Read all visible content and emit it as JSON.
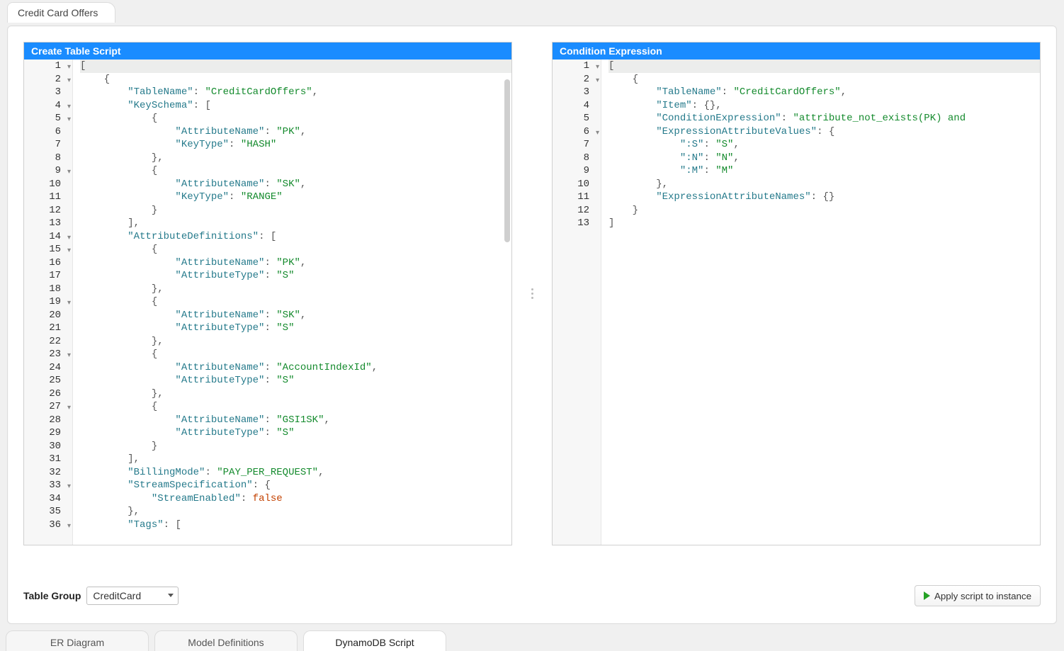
{
  "topTab": {
    "label": "Credit Card Offers"
  },
  "panels": {
    "left": {
      "title": "Create Table Script",
      "gutter": [
        {
          "n": "1",
          "fold": true
        },
        {
          "n": "2",
          "fold": true
        },
        {
          "n": "3",
          "fold": false
        },
        {
          "n": "4",
          "fold": true
        },
        {
          "n": "5",
          "fold": true
        },
        {
          "n": "6",
          "fold": false
        },
        {
          "n": "7",
          "fold": false
        },
        {
          "n": "8",
          "fold": false
        },
        {
          "n": "9",
          "fold": true
        },
        {
          "n": "10",
          "fold": false
        },
        {
          "n": "11",
          "fold": false
        },
        {
          "n": "12",
          "fold": false
        },
        {
          "n": "13",
          "fold": false
        },
        {
          "n": "14",
          "fold": true
        },
        {
          "n": "15",
          "fold": true
        },
        {
          "n": "16",
          "fold": false
        },
        {
          "n": "17",
          "fold": false
        },
        {
          "n": "18",
          "fold": false
        },
        {
          "n": "19",
          "fold": true
        },
        {
          "n": "20",
          "fold": false
        },
        {
          "n": "21",
          "fold": false
        },
        {
          "n": "22",
          "fold": false
        },
        {
          "n": "23",
          "fold": true
        },
        {
          "n": "24",
          "fold": false
        },
        {
          "n": "25",
          "fold": false
        },
        {
          "n": "26",
          "fold": false
        },
        {
          "n": "27",
          "fold": true
        },
        {
          "n": "28",
          "fold": false
        },
        {
          "n": "29",
          "fold": false
        },
        {
          "n": "30",
          "fold": false
        },
        {
          "n": "31",
          "fold": false
        },
        {
          "n": "32",
          "fold": false
        },
        {
          "n": "33",
          "fold": true
        },
        {
          "n": "34",
          "fold": false
        },
        {
          "n": "35",
          "fold": false
        },
        {
          "n": "36",
          "fold": true
        }
      ],
      "code": [
        {
          "hl": true,
          "t": [
            {
              "c": "punc",
              "v": "["
            }
          ]
        },
        {
          "t": [
            {
              "c": "punc",
              "v": "    {"
            }
          ]
        },
        {
          "t": [
            {
              "c": "punc",
              "v": "        "
            },
            {
              "c": "key",
              "v": "\"TableName\""
            },
            {
              "c": "punc",
              "v": ": "
            },
            {
              "c": "str",
              "v": "\"CreditCardOffers\""
            },
            {
              "c": "punc",
              "v": ","
            }
          ]
        },
        {
          "t": [
            {
              "c": "punc",
              "v": "        "
            },
            {
              "c": "key",
              "v": "\"KeySchema\""
            },
            {
              "c": "punc",
              "v": ": ["
            }
          ]
        },
        {
          "t": [
            {
              "c": "punc",
              "v": "            {"
            }
          ]
        },
        {
          "t": [
            {
              "c": "punc",
              "v": "                "
            },
            {
              "c": "key",
              "v": "\"AttributeName\""
            },
            {
              "c": "punc",
              "v": ": "
            },
            {
              "c": "str",
              "v": "\"PK\""
            },
            {
              "c": "punc",
              "v": ","
            }
          ]
        },
        {
          "t": [
            {
              "c": "punc",
              "v": "                "
            },
            {
              "c": "key",
              "v": "\"KeyType\""
            },
            {
              "c": "punc",
              "v": ": "
            },
            {
              "c": "str",
              "v": "\"HASH\""
            }
          ]
        },
        {
          "t": [
            {
              "c": "punc",
              "v": "            },"
            }
          ]
        },
        {
          "t": [
            {
              "c": "punc",
              "v": "            {"
            }
          ]
        },
        {
          "t": [
            {
              "c": "punc",
              "v": "                "
            },
            {
              "c": "key",
              "v": "\"AttributeName\""
            },
            {
              "c": "punc",
              "v": ": "
            },
            {
              "c": "str",
              "v": "\"SK\""
            },
            {
              "c": "punc",
              "v": ","
            }
          ]
        },
        {
          "t": [
            {
              "c": "punc",
              "v": "                "
            },
            {
              "c": "key",
              "v": "\"KeyType\""
            },
            {
              "c": "punc",
              "v": ": "
            },
            {
              "c": "str",
              "v": "\"RANGE\""
            }
          ]
        },
        {
          "t": [
            {
              "c": "punc",
              "v": "            }"
            }
          ]
        },
        {
          "t": [
            {
              "c": "punc",
              "v": "        ],"
            }
          ]
        },
        {
          "t": [
            {
              "c": "punc",
              "v": "        "
            },
            {
              "c": "key",
              "v": "\"AttributeDefinitions\""
            },
            {
              "c": "punc",
              "v": ": ["
            }
          ]
        },
        {
          "t": [
            {
              "c": "punc",
              "v": "            {"
            }
          ]
        },
        {
          "t": [
            {
              "c": "punc",
              "v": "                "
            },
            {
              "c": "key",
              "v": "\"AttributeName\""
            },
            {
              "c": "punc",
              "v": ": "
            },
            {
              "c": "str",
              "v": "\"PK\""
            },
            {
              "c": "punc",
              "v": ","
            }
          ]
        },
        {
          "t": [
            {
              "c": "punc",
              "v": "                "
            },
            {
              "c": "key",
              "v": "\"AttributeType\""
            },
            {
              "c": "punc",
              "v": ": "
            },
            {
              "c": "str",
              "v": "\"S\""
            }
          ]
        },
        {
          "t": [
            {
              "c": "punc",
              "v": "            },"
            }
          ]
        },
        {
          "t": [
            {
              "c": "punc",
              "v": "            {"
            }
          ]
        },
        {
          "t": [
            {
              "c": "punc",
              "v": "                "
            },
            {
              "c": "key",
              "v": "\"AttributeName\""
            },
            {
              "c": "punc",
              "v": ": "
            },
            {
              "c": "str",
              "v": "\"SK\""
            },
            {
              "c": "punc",
              "v": ","
            }
          ]
        },
        {
          "t": [
            {
              "c": "punc",
              "v": "                "
            },
            {
              "c": "key",
              "v": "\"AttributeType\""
            },
            {
              "c": "punc",
              "v": ": "
            },
            {
              "c": "str",
              "v": "\"S\""
            }
          ]
        },
        {
          "t": [
            {
              "c": "punc",
              "v": "            },"
            }
          ]
        },
        {
          "t": [
            {
              "c": "punc",
              "v": "            {"
            }
          ]
        },
        {
          "t": [
            {
              "c": "punc",
              "v": "                "
            },
            {
              "c": "key",
              "v": "\"AttributeName\""
            },
            {
              "c": "punc",
              "v": ": "
            },
            {
              "c": "str",
              "v": "\"AccountIndexId\""
            },
            {
              "c": "punc",
              "v": ","
            }
          ]
        },
        {
          "t": [
            {
              "c": "punc",
              "v": "                "
            },
            {
              "c": "key",
              "v": "\"AttributeType\""
            },
            {
              "c": "punc",
              "v": ": "
            },
            {
              "c": "str",
              "v": "\"S\""
            }
          ]
        },
        {
          "t": [
            {
              "c": "punc",
              "v": "            },"
            }
          ]
        },
        {
          "t": [
            {
              "c": "punc",
              "v": "            {"
            }
          ]
        },
        {
          "t": [
            {
              "c": "punc",
              "v": "                "
            },
            {
              "c": "key",
              "v": "\"AttributeName\""
            },
            {
              "c": "punc",
              "v": ": "
            },
            {
              "c": "str",
              "v": "\"GSI1SK\""
            },
            {
              "c": "punc",
              "v": ","
            }
          ]
        },
        {
          "t": [
            {
              "c": "punc",
              "v": "                "
            },
            {
              "c": "key",
              "v": "\"AttributeType\""
            },
            {
              "c": "punc",
              "v": ": "
            },
            {
              "c": "str",
              "v": "\"S\""
            }
          ]
        },
        {
          "t": [
            {
              "c": "punc",
              "v": "            }"
            }
          ]
        },
        {
          "t": [
            {
              "c": "punc",
              "v": "        ],"
            }
          ]
        },
        {
          "t": [
            {
              "c": "punc",
              "v": "        "
            },
            {
              "c": "key",
              "v": "\"BillingMode\""
            },
            {
              "c": "punc",
              "v": ": "
            },
            {
              "c": "str",
              "v": "\"PAY_PER_REQUEST\""
            },
            {
              "c": "punc",
              "v": ","
            }
          ]
        },
        {
          "t": [
            {
              "c": "punc",
              "v": "        "
            },
            {
              "c": "key",
              "v": "\"StreamSpecification\""
            },
            {
              "c": "punc",
              "v": ": {"
            }
          ]
        },
        {
          "t": [
            {
              "c": "punc",
              "v": "            "
            },
            {
              "c": "key",
              "v": "\"StreamEnabled\""
            },
            {
              "c": "punc",
              "v": ": "
            },
            {
              "c": "bool",
              "v": "false"
            }
          ]
        },
        {
          "t": [
            {
              "c": "punc",
              "v": "        },"
            }
          ]
        },
        {
          "t": [
            {
              "c": "punc",
              "v": "        "
            },
            {
              "c": "key",
              "v": "\"Tags\""
            },
            {
              "c": "punc",
              "v": ": ["
            }
          ]
        }
      ]
    },
    "right": {
      "title": "Condition Expression",
      "gutter": [
        {
          "n": "1",
          "fold": true
        },
        {
          "n": "2",
          "fold": true
        },
        {
          "n": "3",
          "fold": false
        },
        {
          "n": "4",
          "fold": false
        },
        {
          "n": "5",
          "fold": false
        },
        {
          "n": "6",
          "fold": true
        },
        {
          "n": "7",
          "fold": false
        },
        {
          "n": "8",
          "fold": false
        },
        {
          "n": "9",
          "fold": false
        },
        {
          "n": "10",
          "fold": false
        },
        {
          "n": "11",
          "fold": false
        },
        {
          "n": "12",
          "fold": false
        },
        {
          "n": "13",
          "fold": false
        }
      ],
      "code": [
        {
          "hl": true,
          "t": [
            {
              "c": "punc",
              "v": "["
            }
          ]
        },
        {
          "t": [
            {
              "c": "punc",
              "v": "    {"
            }
          ]
        },
        {
          "t": [
            {
              "c": "punc",
              "v": "        "
            },
            {
              "c": "key",
              "v": "\"TableName\""
            },
            {
              "c": "punc",
              "v": ": "
            },
            {
              "c": "str",
              "v": "\"CreditCardOffers\""
            },
            {
              "c": "punc",
              "v": ","
            }
          ]
        },
        {
          "t": [
            {
              "c": "punc",
              "v": "        "
            },
            {
              "c": "key",
              "v": "\"Item\""
            },
            {
              "c": "punc",
              "v": ": {},"
            }
          ]
        },
        {
          "t": [
            {
              "c": "punc",
              "v": "        "
            },
            {
              "c": "key",
              "v": "\"ConditionExpression\""
            },
            {
              "c": "punc",
              "v": ": "
            },
            {
              "c": "str",
              "v": "\"attribute_not_exists(PK) and"
            }
          ]
        },
        {
          "t": [
            {
              "c": "punc",
              "v": "        "
            },
            {
              "c": "key",
              "v": "\"ExpressionAttributeValues\""
            },
            {
              "c": "punc",
              "v": ": {"
            }
          ]
        },
        {
          "t": [
            {
              "c": "punc",
              "v": "            "
            },
            {
              "c": "key",
              "v": "\":S\""
            },
            {
              "c": "punc",
              "v": ": "
            },
            {
              "c": "str",
              "v": "\"S\""
            },
            {
              "c": "punc",
              "v": ","
            }
          ]
        },
        {
          "t": [
            {
              "c": "punc",
              "v": "            "
            },
            {
              "c": "key",
              "v": "\":N\""
            },
            {
              "c": "punc",
              "v": ": "
            },
            {
              "c": "str",
              "v": "\"N\""
            },
            {
              "c": "punc",
              "v": ","
            }
          ]
        },
        {
          "t": [
            {
              "c": "punc",
              "v": "            "
            },
            {
              "c": "key",
              "v": "\":M\""
            },
            {
              "c": "punc",
              "v": ": "
            },
            {
              "c": "str",
              "v": "\"M\""
            }
          ]
        },
        {
          "t": [
            {
              "c": "punc",
              "v": "        },"
            }
          ]
        },
        {
          "t": [
            {
              "c": "punc",
              "v": "        "
            },
            {
              "c": "key",
              "v": "\"ExpressionAttributeNames\""
            },
            {
              "c": "punc",
              "v": ": {}"
            }
          ]
        },
        {
          "t": [
            {
              "c": "punc",
              "v": "    }"
            }
          ]
        },
        {
          "t": [
            {
              "c": "punc",
              "v": "]"
            }
          ]
        }
      ]
    }
  },
  "controls": {
    "tableGroupLabel": "Table Group",
    "tableGroupValue": "CreditCard",
    "applyLabel": "Apply script to instance"
  },
  "bottomTabs": [
    {
      "label": "ER Diagram",
      "active": false
    },
    {
      "label": "Model Definitions",
      "active": false
    },
    {
      "label": "DynamoDB Script",
      "active": true
    }
  ]
}
